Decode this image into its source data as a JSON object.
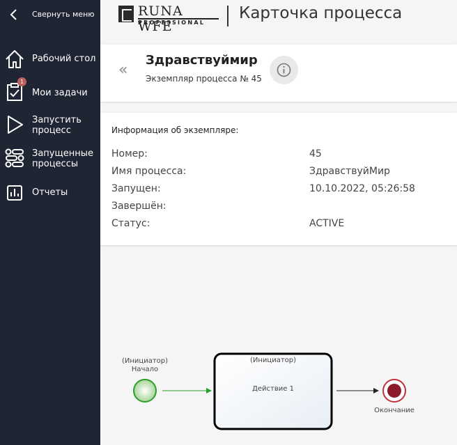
{
  "sidebar": {
    "collapse_label": "Свернуть меню",
    "items": [
      {
        "label": "Рабочий стол",
        "icon": "home-icon"
      },
      {
        "label": "Мои задачи",
        "icon": "clipboard-check-icon",
        "badge": "1"
      },
      {
        "label": "Запустить процесс",
        "icon": "play-icon"
      },
      {
        "label": "Запущенные процессы",
        "icon": "process-flow-icon"
      },
      {
        "label": "Отчеты",
        "icon": "bar-chart-icon"
      }
    ],
    "background": "#1f2533"
  },
  "header": {
    "logo_name": "RUNA WFE",
    "logo_sub": "PROFESSIONAL",
    "title": "Карточка процесса"
  },
  "process": {
    "back_label": "«",
    "name": "Здравствуймир",
    "subtitle": "Экземпляр процесса № 45"
  },
  "info": {
    "title": "Информация об экземпляре:",
    "rows": [
      {
        "label": "Номер:",
        "value": "45"
      },
      {
        "label": "Имя процесса:",
        "value": "ЗдравствуйМир"
      },
      {
        "label": "Запущен:",
        "value": "10.10.2022, 05:26:58"
      },
      {
        "label": "Завершён:",
        "value": ""
      },
      {
        "label": "Статус:",
        "value": "ACTIVE"
      }
    ]
  },
  "diagram": {
    "start_role": "(Инициатор)",
    "start_label": "Начало",
    "task_role": "(Инициатор)",
    "task_label": "Действие 1",
    "end_label": "Окончание",
    "start_color": "#2aa02a",
    "end_color": "#8b1a2b"
  }
}
